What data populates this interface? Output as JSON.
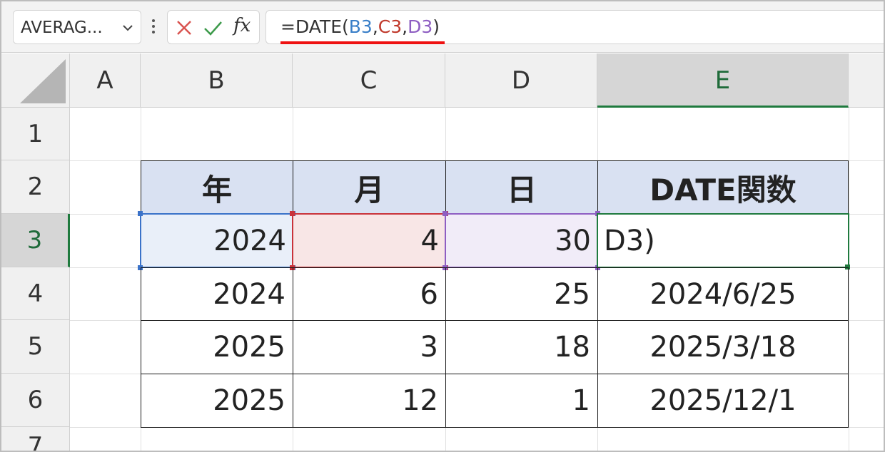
{
  "namebox": {
    "value": "AVERAG..."
  },
  "formula_bar": {
    "formula_parts": [
      {
        "text": "=DATE(",
        "color": "#333333"
      },
      {
        "text": "B3",
        "color": "#3a7fc8"
      },
      {
        "text": ",",
        "color": "#333333"
      },
      {
        "text": "C3",
        "color": "#c0392b"
      },
      {
        "text": ",",
        "color": "#333333"
      },
      {
        "text": "D3",
        "color": "#8e5ec2"
      },
      {
        "text": ")",
        "color": "#333333"
      }
    ],
    "fx_label": "fx"
  },
  "columns": [
    "A",
    "B",
    "C",
    "D",
    "E"
  ],
  "selected_column": "E",
  "rows": [
    "1",
    "2",
    "3",
    "4",
    "5",
    "6",
    "7"
  ],
  "selected_row": "3",
  "table": {
    "headers": [
      "年",
      "月",
      "日",
      "DATE関数"
    ],
    "rows": [
      [
        "2024",
        "4",
        "30",
        "D3)"
      ],
      [
        "2024",
        "6",
        "25",
        "2024/6/25"
      ],
      [
        "2025",
        "3",
        "18",
        "2025/3/18"
      ],
      [
        "2025",
        "12",
        "1",
        "2025/12/1"
      ]
    ]
  },
  "ref_colors": {
    "B3": "#3a72c9",
    "C3": "#c9333b",
    "D3": "#8e5ec2",
    "edit": "#1f7a3e",
    "header_fill": "#d9e1f2"
  }
}
